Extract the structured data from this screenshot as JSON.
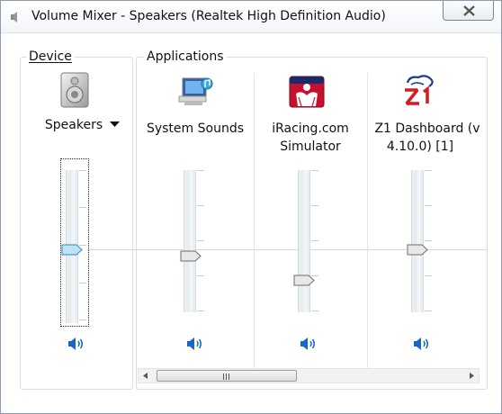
{
  "window": {
    "title": "Volume Mixer - Speakers (Realtek High Definition Audio)",
    "icon": "speaker-window-icon",
    "close_icon": "close-icon"
  },
  "device": {
    "group_label": "Device",
    "name": "Speakers",
    "icon": "speakers-device-icon",
    "dropdown_icon": "chevron-down-icon",
    "volume": 0.5,
    "mute_icon": "speaker-volume-icon"
  },
  "applications": {
    "group_label": "Applications",
    "items": [
      {
        "name_line1": "System Sounds",
        "name_line2": "",
        "icon": "system-sounds-icon",
        "volume": 0.49,
        "mute_icon": "speaker-volume-icon"
      },
      {
        "name_line1": "iRacing.com",
        "name_line2": "Simulator",
        "icon": "iracing-icon",
        "volume": 0.28,
        "mute_icon": "speaker-volume-icon"
      },
      {
        "name_line1": "Z1 Dashboard (v",
        "name_line2": "4.10.0) [1]",
        "icon": "z1-dashboard-icon",
        "volume": 0.54,
        "mute_icon": "speaker-volume-icon"
      }
    ]
  },
  "colors": {
    "accent": "#1a66c4",
    "thumb_device": "#bfe3f5",
    "thumb_app": "#e8e8e8"
  }
}
